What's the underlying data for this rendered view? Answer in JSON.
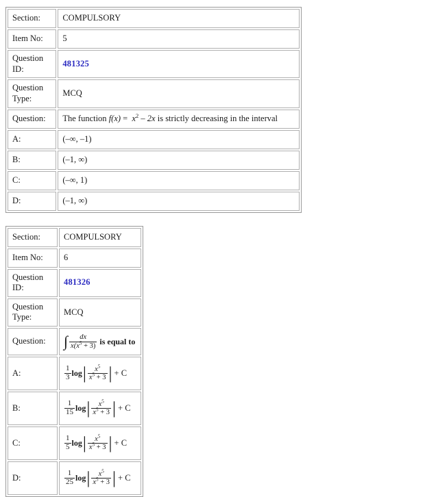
{
  "page": {
    "background": "#ffffff",
    "question_id_color": "#2a2ac0"
  },
  "labels": {
    "section": "Section:",
    "item_no": "Item No:",
    "question_id": "Question ID:",
    "question_type": "Question Type:",
    "question": "Question:",
    "option_a": "A:",
    "option_b": "B:",
    "option_c": "C:",
    "option_d": "D:"
  },
  "items": [
    {
      "section": "COMPULSORY",
      "item_no": "5",
      "question_id": "481325",
      "question_type": "MCQ",
      "question_text_parts": {
        "lead": "The function ",
        "fx": "f(x)",
        "equals": " = ",
        "expr_base": "x",
        "expr_exp": "2",
        "expr_tail": " – 2x",
        "trail": " is strictly decreasing in the interval"
      },
      "question_plain": "The function f(x) = x² – 2x is strictly decreasing in the interval",
      "options": [
        {
          "key": "A",
          "text": "(–∞, –1)"
        },
        {
          "key": "B",
          "text": "(–1, ∞)"
        },
        {
          "key": "C",
          "text": "(–∞, 1)"
        },
        {
          "key": "D",
          "text": "(–1, ∞)"
        }
      ]
    },
    {
      "section": "COMPULSORY",
      "item_no": "6",
      "question_id": "481326",
      "question_type": "MCQ",
      "question_plain": "∫ dx / (x(x⁵ + 3)) is equal to",
      "question_math": {
        "integral_sign": "∫",
        "numerator": "dx",
        "denominator_prefix": "x(x",
        "denominator_exp": "5",
        "denominator_suffix": " + 3)",
        "trailing_text": "is equal to"
      },
      "options": [
        {
          "key": "A",
          "plain": "(1/3) log |x⁵/(x⁵ + 3)| + C",
          "coef_num": "1",
          "coef_den": "3",
          "log_label": "log",
          "arg_num_base": "x",
          "arg_num_exp": "5",
          "arg_den_base": "x",
          "arg_den_exp": "5",
          "arg_den_tail": " + 3",
          "constant": "+ C"
        },
        {
          "key": "B",
          "plain": "(1/15) log |x⁵/(x⁵ + 3)| + C",
          "coef_num": "1",
          "coef_den": "15",
          "log_label": "log",
          "arg_num_base": "x",
          "arg_num_exp": "5",
          "arg_den_base": "x",
          "arg_den_exp": "5",
          "arg_den_tail": " + 3",
          "constant": "+ C"
        },
        {
          "key": "C",
          "plain": "(1/5) log |x⁵/(x⁵ + 3)| + C",
          "coef_num": "1",
          "coef_den": "5",
          "log_label": "log",
          "arg_num_base": "x",
          "arg_num_exp": "5",
          "arg_den_base": "x",
          "arg_den_exp": "5",
          "arg_den_tail": " + 3",
          "constant": "+ C"
        },
        {
          "key": "D",
          "plain": "(1/25) log |x⁵/(x⁵ + 3)| + C",
          "coef_num": "1",
          "coef_den": "25",
          "log_label": "log",
          "arg_num_base": "x",
          "arg_num_exp": "5",
          "arg_den_base": "x",
          "arg_den_exp": "5",
          "arg_den_tail": " + 3",
          "constant": "+ C"
        }
      ]
    }
  ]
}
